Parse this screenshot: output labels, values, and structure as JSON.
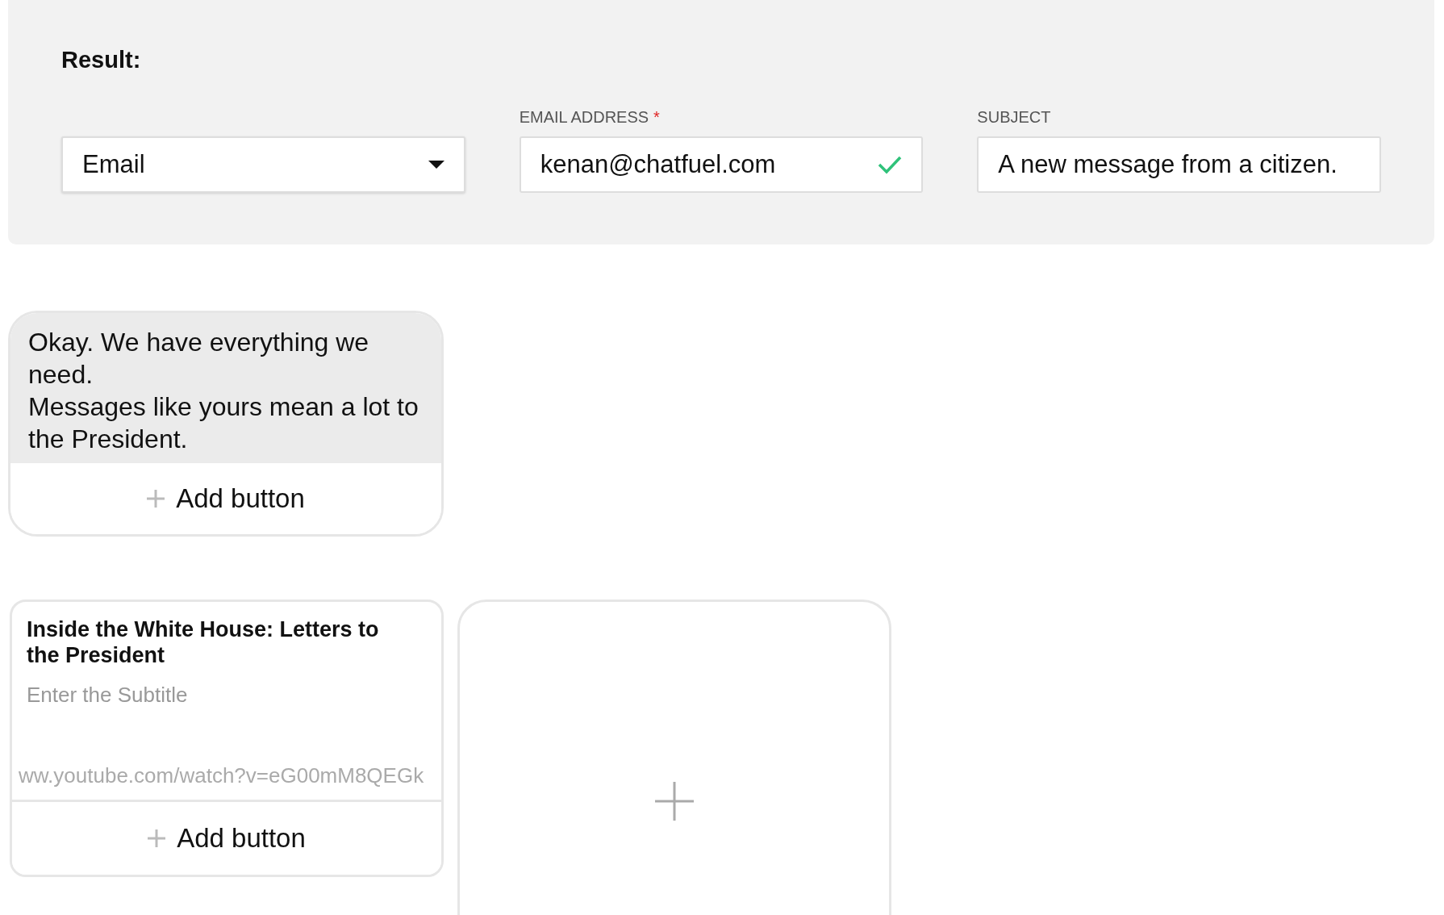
{
  "result_panel": {
    "heading": "Result:",
    "action_select": {
      "value": "Email"
    },
    "email_field": {
      "label": "EMAIL ADDRESS",
      "required_mark": "*",
      "value": "kenan@chatfuel.com",
      "valid": true
    },
    "subject_field": {
      "label": "SUBJECT",
      "value": "A new message from a citizen."
    }
  },
  "text_card": {
    "lines": [
      "Okay. We have everything we need.",
      "Messages like yours mean a lot to the President."
    ],
    "add_button": "Add button"
  },
  "gallery": {
    "cards": [
      {
        "kind": "item",
        "title": "Inside the White House: Letters to the President",
        "subtitle_placeholder": "Enter the Subtitle",
        "url": "ww.youtube.com/watch?v=eG00mM8QEGk",
        "add_button": "Add button"
      },
      {
        "kind": "add"
      }
    ]
  }
}
